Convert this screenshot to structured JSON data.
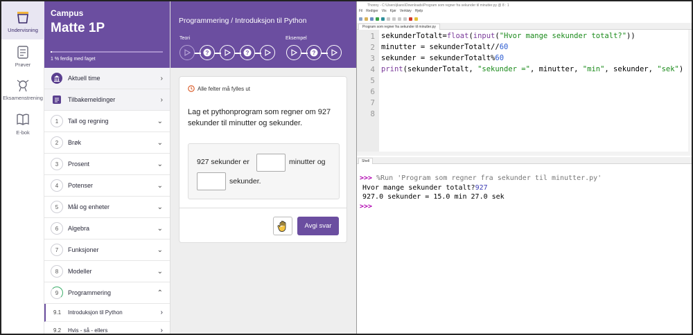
{
  "rail": {
    "items": [
      {
        "label": "Undervisning",
        "icon": "basket-icon",
        "active": true
      },
      {
        "label": "Prøver",
        "icon": "test-icon",
        "active": false
      },
      {
        "label": "Eksamenstrening",
        "icon": "medal-icon",
        "active": false
      },
      {
        "label": "E-bok",
        "icon": "book-icon",
        "active": false
      }
    ]
  },
  "course": {
    "kicker": "Campus",
    "title": "Matte 1P",
    "progress": 0.01,
    "progress_label": "1 % ferdig med faget"
  },
  "sidebar": {
    "items": [
      {
        "label": "Aktuell time",
        "icon": "building-icon"
      },
      {
        "label": "Tilbakemeldinger",
        "icon": "feedback-icon"
      },
      {
        "num": "1",
        "label": "Tall og regning"
      },
      {
        "num": "2",
        "label": "Brøk"
      },
      {
        "num": "3",
        "label": "Prosent"
      },
      {
        "num": "4",
        "label": "Potenser"
      },
      {
        "num": "5",
        "label": "Mål og enheter"
      },
      {
        "num": "6",
        "label": "Algebra"
      },
      {
        "num": "7",
        "label": "Funksjoner"
      },
      {
        "num": "8",
        "label": "Modeller"
      },
      {
        "num": "9",
        "label": "Programmering"
      }
    ],
    "subitems": [
      {
        "num": "9.1",
        "label": "Introduksjon til Python"
      },
      {
        "num": "9.2",
        "label": "Hvis - så - ellers"
      }
    ]
  },
  "lesson": {
    "breadcrumb": "Programmering / Introduksjon til Python",
    "teori_label": "Teori",
    "eksempel_label": "Eksempel",
    "requirement": "Alle felter må fylles ut",
    "question": "Lag et pythonprogram som regner om 927 sekunder til minutter og sekunder.",
    "answer_prefix": "927 sekunder er",
    "answer_mid": "minutter og",
    "answer_suffix": "sekunder.",
    "submit_label": "Avgi svar"
  },
  "ide": {
    "title": "Thonny - C:\\Users\\jkans\\Downloads\\Program som regner fra sekunder til minutter.py @ 8 : 1",
    "menu": [
      "Fil",
      "Rediger",
      "Vis",
      "Kjør",
      "Verktøy",
      "Hjelp"
    ],
    "editor_tab": "Program som regner fra sekunder til minutter.py",
    "line_numbers": [
      "1",
      "2",
      "3",
      "4",
      "5",
      "6",
      "7",
      "8"
    ],
    "code": {
      "l1": [
        "sekunderTotalt=",
        "float",
        "(",
        "input",
        "(",
        "\"Hvor mange sekunder totalt?\"",
        "))"
      ],
      "l2": [
        "minutter = sekunderTotalt//",
        "60"
      ],
      "l3": [
        "sekunder = sekunderTotalt%",
        "60"
      ],
      "l4": [
        "print",
        "(sekunderTotalt, ",
        "\"sekunder =\"",
        ", minutter, ",
        "\"min\"",
        ", sekunder, ",
        "\"sek\"",
        ")"
      ]
    },
    "shell_tab": "Shell",
    "shell": {
      "prompt": ">>>",
      "run_cmd": "%Run 'Program som regner fra sekunder til minutter.py'",
      "out1_text": "Hvor mange sekunder totalt?",
      "out1_input": "927",
      "out2": "927.0 sekunder = 15.0 min 27.0 sek"
    }
  }
}
